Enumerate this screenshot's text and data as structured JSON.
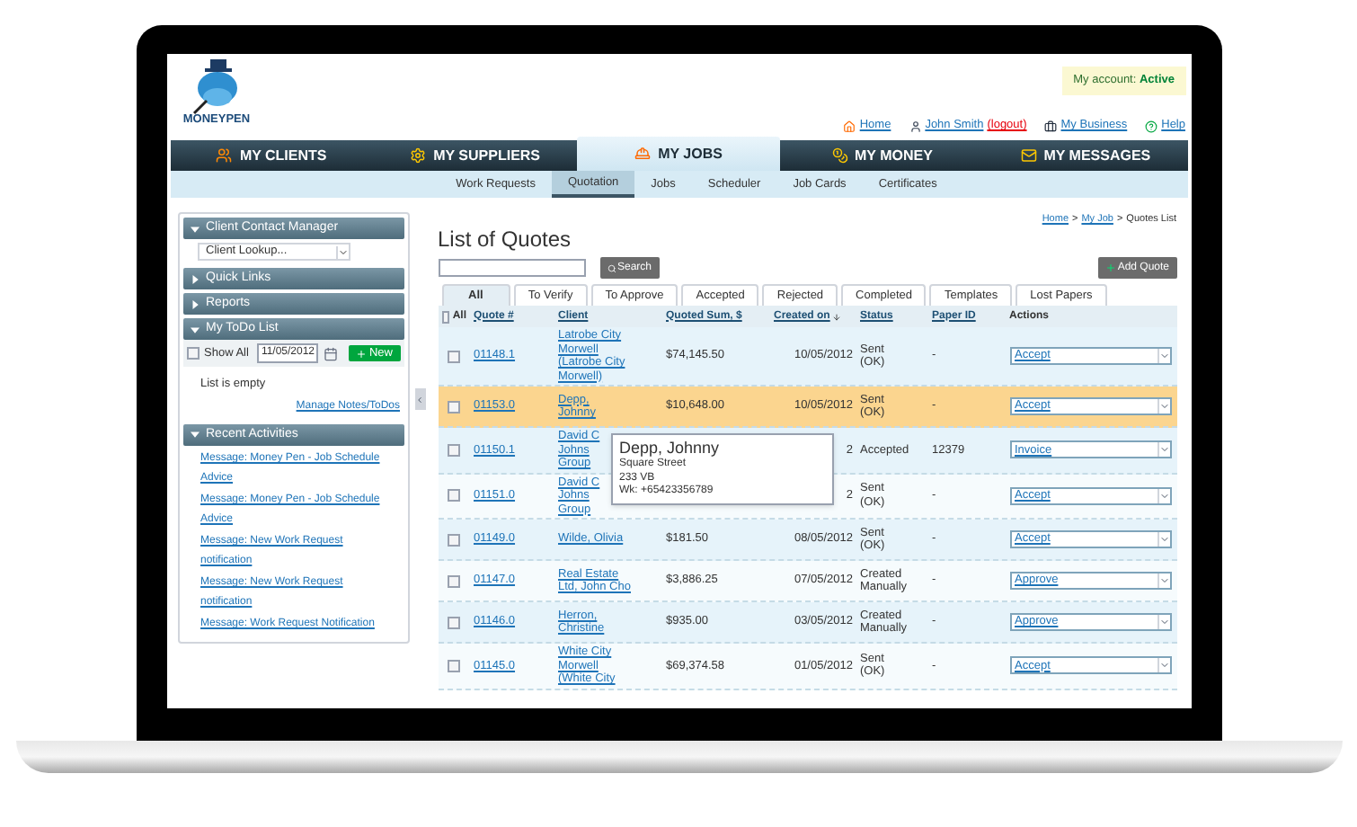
{
  "logo": {
    "wordmark": "MONEYPEN"
  },
  "account": {
    "label": "My account:",
    "status": "Active"
  },
  "top_links": [
    {
      "kind": "home",
      "label": "Home"
    },
    {
      "kind": "user",
      "label": "John Smith",
      "extra": "(logout)"
    },
    {
      "kind": "business",
      "label": "My Business"
    },
    {
      "kind": "help",
      "label": "Help"
    }
  ],
  "main_nav": [
    {
      "kind": "clients",
      "label": "MY CLIENTS",
      "selected": false
    },
    {
      "kind": "suppliers",
      "label": "MY SUPPLIERS",
      "selected": false
    },
    {
      "kind": "jobs",
      "label": "MY JOBS",
      "selected": true
    },
    {
      "kind": "money",
      "label": "MY MONEY",
      "selected": false
    },
    {
      "kind": "messages",
      "label": "MY MESSAGES",
      "selected": false
    }
  ],
  "sub_nav": [
    {
      "label": "Work Requests",
      "selected": false
    },
    {
      "label": "Quotation",
      "selected": true
    },
    {
      "label": "Jobs",
      "selected": false
    },
    {
      "label": "Scheduler",
      "selected": false
    },
    {
      "label": "Job Cards",
      "selected": false
    },
    {
      "label": "Certificates",
      "selected": false
    }
  ],
  "sidebar": {
    "panels": [
      {
        "kind": "lookup",
        "title": "Client Contact Manager",
        "expanded": true,
        "select": "Client Lookup..."
      },
      {
        "kind": "plain",
        "title": "Quick Links",
        "expanded": false
      },
      {
        "kind": "plain",
        "title": "Reports",
        "expanded": false
      },
      {
        "kind": "todo",
        "title": "My ToDo List",
        "expanded": true,
        "show_all": {
          "label": "Show All",
          "checked": false
        },
        "date": "11/05/2012",
        "new_button": "New",
        "empty_text": "List is empty",
        "manage_link": "Manage Notes/ToDos"
      },
      {
        "kind": "links",
        "title": "Recent Activities",
        "expanded": true,
        "links": [
          "Message: Money Pen - Job Schedule Advice",
          "Message: Money Pen - Job Schedule Advice",
          "Message: New Work Request notification",
          "Message: New Work Request notification",
          "Message: Work Request Notification"
        ]
      }
    ]
  },
  "breadcrumb": [
    {
      "kind": "link",
      "label": "Home"
    },
    {
      "kind": "sep",
      "label": ">"
    },
    {
      "kind": "link",
      "label": "My Job"
    },
    {
      "kind": "sep",
      "label": ">"
    },
    {
      "kind": "current",
      "label": "Quotes List"
    }
  ],
  "title": "List of Quotes",
  "search": {
    "button": "Search"
  },
  "add_button": "Add Quote",
  "tabs": [
    {
      "label": "All",
      "selected": true
    },
    {
      "label": "To Verify",
      "selected": false
    },
    {
      "label": "To Approve",
      "selected": false
    },
    {
      "label": "Accepted",
      "selected": false
    },
    {
      "label": "Rejected",
      "selected": false
    },
    {
      "label": "Completed",
      "selected": false
    },
    {
      "label": "Templates",
      "selected": false
    },
    {
      "label": "Lost Papers",
      "selected": false
    }
  ],
  "table": {
    "columns": [
      {
        "kind": "select_all",
        "label": "All",
        "checked": false,
        "link": false
      },
      {
        "label": "Quote #",
        "link": true,
        "sorted": false
      },
      {
        "label": "Client",
        "link": true,
        "sorted": false
      },
      {
        "label": "Quoted Sum, $",
        "link": true,
        "sorted": false
      },
      {
        "label": "Created on",
        "link": true,
        "sorted": true
      },
      {
        "label": "Status",
        "link": true,
        "sorted": false
      },
      {
        "label": "Paper ID",
        "link": true,
        "sorted": false
      },
      {
        "label": "Actions",
        "link": false,
        "sorted": false
      }
    ],
    "rows": [
      {
        "checked": false,
        "selected": false,
        "quote": "01148.1",
        "client": "Latrobe City\nMorwell\n(Latrobe City\nMorwell)",
        "sum": "$74,145.50",
        "date": "10/05/2012",
        "status": "Sent\n(OK)",
        "paper_id": "-",
        "action": "Accept"
      },
      {
        "checked": false,
        "selected": true,
        "quote": "01153.0",
        "client": "Depp,\nJohnny",
        "sum": "$10,648.00",
        "date": "10/05/2012",
        "status": "Sent\n(OK)",
        "paper_id": "-",
        "action": "Accept"
      },
      {
        "checked": false,
        "selected": false,
        "quote": "01150.1",
        "client": "David C\nJohns\nGroup",
        "date": "2",
        "status": "Accepted",
        "paper_id": "12379",
        "action": "Invoice"
      },
      {
        "checked": false,
        "selected": false,
        "quote": "01151.0",
        "client": "David C\nJohns\nGroup",
        "date": "2",
        "status": "Sent\n(OK)",
        "paper_id": "-",
        "action": "Accept"
      },
      {
        "checked": false,
        "selected": false,
        "quote": "01149.0",
        "client": "Wilde, Olivia",
        "sum": "$181.50",
        "date": "08/05/2012",
        "status": "Sent\n(OK)",
        "paper_id": "-",
        "action": "Accept"
      },
      {
        "checked": false,
        "selected": false,
        "quote": "01147.0",
        "client": "Real Estate\nLtd, John Cho",
        "sum": "$3,886.25",
        "date": "07/05/2012",
        "status": "Created\nManually",
        "paper_id": "-",
        "action": "Approve"
      },
      {
        "checked": false,
        "selected": false,
        "quote": "01146.0",
        "client": "Herron,\nChristine",
        "sum": "$935.00",
        "date": "03/05/2012",
        "status": "Created\nManually",
        "paper_id": "-",
        "action": "Approve"
      },
      {
        "checked": false,
        "selected": false,
        "quote": "01145.0",
        "client": "White City\nMorwell\n(White City",
        "sum": "$69,374.58",
        "date": "01/05/2012",
        "status": "Sent\n(OK)",
        "paper_id": "-",
        "action": "Accept"
      }
    ]
  },
  "tooltip": {
    "name": "Depp, Johnny",
    "details": "Square Street\n233 VB\nWk: +65423356789"
  }
}
